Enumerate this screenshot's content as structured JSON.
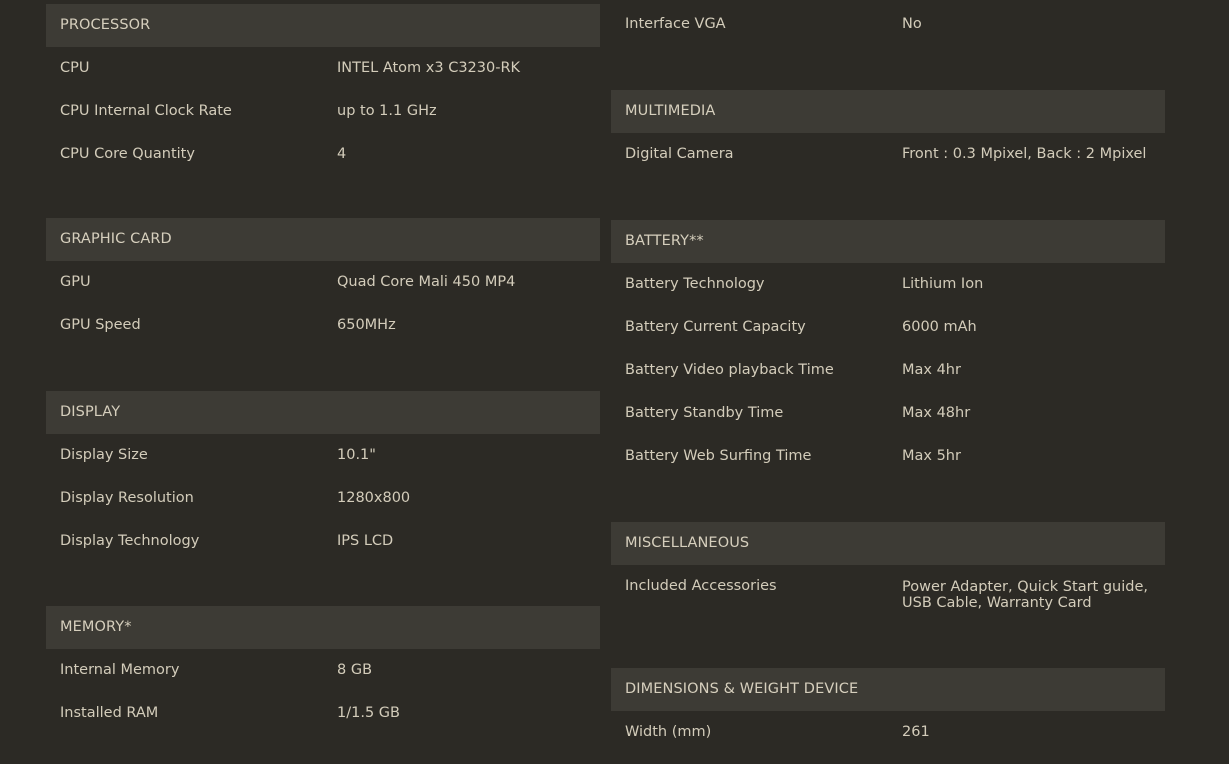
{
  "left": {
    "processor": {
      "title": "PROCESSOR",
      "rows": [
        {
          "label": "CPU",
          "value": "INTEL Atom x3 C3230-RK"
        },
        {
          "label": "CPU Internal Clock Rate",
          "value": "up to 1.1 GHz"
        },
        {
          "label": "CPU Core Quantity",
          "value": "4"
        }
      ]
    },
    "graphic_card": {
      "title": "GRAPHIC CARD",
      "rows": [
        {
          "label": "GPU",
          "value": "Quad Core Mali 450 MP4"
        },
        {
          "label": "GPU Speed",
          "value": "650MHz"
        }
      ]
    },
    "display": {
      "title": "DISPLAY",
      "rows": [
        {
          "label": "Display Size",
          "value": "10.1\""
        },
        {
          "label": "Display Resolution",
          "value": "1280x800"
        },
        {
          "label": "Display Technology",
          "value": "IPS LCD"
        }
      ]
    },
    "memory": {
      "title": "MEMORY*",
      "rows": [
        {
          "label": "Internal Memory",
          "value": "8 GB"
        },
        {
          "label": "Installed RAM",
          "value": "1/1.5 GB"
        }
      ]
    }
  },
  "right": {
    "interface": {
      "rows": [
        {
          "label": "Interface VGA",
          "value": "No"
        }
      ]
    },
    "multimedia": {
      "title": "MULTIMEDIA",
      "rows": [
        {
          "label": "Digital Camera",
          "value": "Front : 0.3 Mpixel, Back : 2 Mpixel"
        }
      ]
    },
    "battery": {
      "title": "BATTERY**",
      "rows": [
        {
          "label": "Battery Technology",
          "value": "Lithium Ion"
        },
        {
          "label": "Battery Current Capacity",
          "value": "6000 mAh"
        },
        {
          "label": "Battery Video playback Time",
          "value": "Max 4hr"
        },
        {
          "label": "Battery Standby Time",
          "value": "Max 48hr"
        },
        {
          "label": "Battery Web Surfing Time",
          "value": "Max 5hr"
        }
      ]
    },
    "miscellaneous": {
      "title": "MISCELLANEOUS",
      "rows": [
        {
          "label": "Included Accessories",
          "value": "Power Adapter, Quick Start guide, USB Cable, Warranty Card"
        }
      ]
    },
    "dimensions": {
      "title": "DIMENSIONS & WEIGHT DEVICE",
      "rows": [
        {
          "label": "Width (mm)",
          "value": "261"
        }
      ]
    }
  }
}
